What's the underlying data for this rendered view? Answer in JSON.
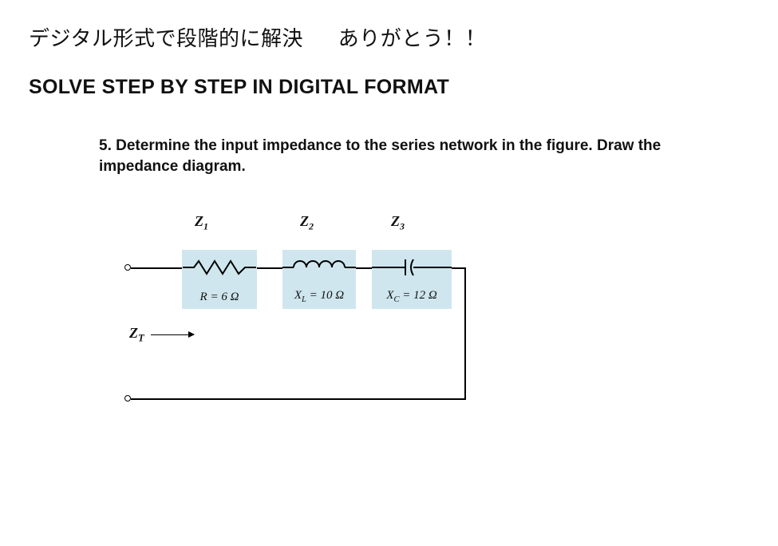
{
  "header": {
    "jp_left": "デジタル形式で段階的に解決",
    "jp_right": "ありがとう！！",
    "en": "SOLVE STEP BY STEP IN DIGITAL FORMAT"
  },
  "problem": {
    "number": "5.",
    "text": "Determine the input impedance to the series network in the figure. Draw the impedance diagram."
  },
  "circuit": {
    "z_labels": {
      "z1": "Z",
      "z1_sub": "1",
      "z2": "Z",
      "z2_sub": "2",
      "z3": "Z",
      "z3_sub": "3"
    },
    "zt": {
      "sym": "Z",
      "sub": "T"
    },
    "components": {
      "resistor": {
        "value": "R = 6 Ω"
      },
      "inductor": {
        "value_sym": "X",
        "value_sub": "L",
        "value_rest": " = 10 Ω"
      },
      "capacitor": {
        "value_sym": "X",
        "value_sub": "C",
        "value_rest": " = 12 Ω"
      }
    }
  }
}
